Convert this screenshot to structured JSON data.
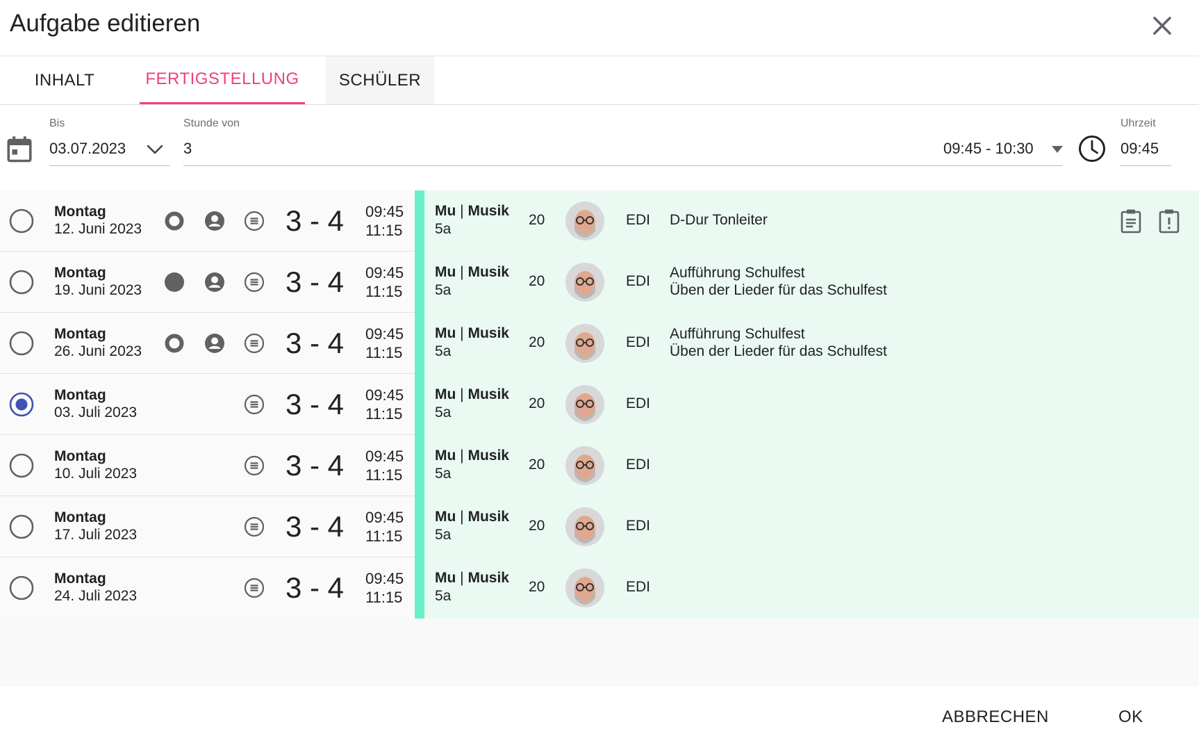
{
  "dialog": {
    "title": "Aufgabe editieren"
  },
  "tabs": [
    {
      "label": "INHALT"
    },
    {
      "label": "FERTIGSTELLUNG"
    },
    {
      "label": "SCHÜLER"
    }
  ],
  "form": {
    "bis": {
      "label": "Bis",
      "value": "03.07.2023"
    },
    "stunde": {
      "label": "Stunde von",
      "value": "3",
      "range": "09:45 - 10:30"
    },
    "uhrzeit": {
      "label": "Uhrzeit",
      "value": "09:45"
    }
  },
  "colors": {
    "accent_pink": "#ef3f82",
    "lesson_bar": "#69f0c8",
    "lesson_bg": "#eafaf3",
    "radio_selected": "#3f51b5",
    "icon_gray": "#616161"
  },
  "lessons": [
    {
      "day": "Montag",
      "date": "12. Juni 2023",
      "status_icon": "ring-icon",
      "periods": "3 - 4",
      "start": "09:45",
      "end": "11:15",
      "subject_short": "Mu",
      "subject_long": "Musik",
      "class": "5a",
      "count": "20",
      "teacher": "EDI",
      "topic1": "D-Dur Tonleiter",
      "topic2": ""
    },
    {
      "day": "Montag",
      "date": "19. Juni 2023",
      "status_icon": "filled-circle-icon",
      "periods": "3 - 4",
      "start": "09:45",
      "end": "11:15",
      "subject_short": "Mu",
      "subject_long": "Musik",
      "class": "5a",
      "count": "20",
      "teacher": "EDI",
      "topic1": "Aufführung Schulfest",
      "topic2": "Üben der Lieder für das Schulfest"
    },
    {
      "day": "Montag",
      "date": "26. Juni 2023",
      "status_icon": "ring-icon",
      "periods": "3 - 4",
      "start": "09:45",
      "end": "11:15",
      "subject_short": "Mu",
      "subject_long": "Musik",
      "class": "5a",
      "count": "20",
      "teacher": "EDI",
      "topic1": "Aufführung Schulfest",
      "topic2": "Üben der Lieder für das Schulfest"
    },
    {
      "day": "Montag",
      "date": "03. Juli 2023",
      "periods": "3 - 4",
      "start": "09:45",
      "end": "11:15",
      "subject_short": "Mu",
      "subject_long": "Musik",
      "class": "5a",
      "count": "20",
      "teacher": "EDI",
      "topic1": "",
      "topic2": ""
    },
    {
      "day": "Montag",
      "date": "10. Juli 2023",
      "periods": "3 - 4",
      "start": "09:45",
      "end": "11:15",
      "subject_short": "Mu",
      "subject_long": "Musik",
      "class": "5a",
      "count": "20",
      "teacher": "EDI",
      "topic1": "",
      "topic2": ""
    },
    {
      "day": "Montag",
      "date": "17. Juli 2023",
      "periods": "3 - 4",
      "start": "09:45",
      "end": "11:15",
      "subject_short": "Mu",
      "subject_long": "Musik",
      "class": "5a",
      "count": "20",
      "teacher": "EDI",
      "topic1": "",
      "topic2": ""
    },
    {
      "day": "Montag",
      "date": "24. Juli 2023",
      "periods": "3 - 4",
      "start": "09:45",
      "end": "11:15",
      "subject_short": "Mu",
      "subject_long": "Musik",
      "class": "5a",
      "count": "20",
      "teacher": "EDI",
      "topic1": "",
      "topic2": ""
    }
  ],
  "footer": {
    "cancel": "ABBRECHEN",
    "ok": "OK"
  }
}
